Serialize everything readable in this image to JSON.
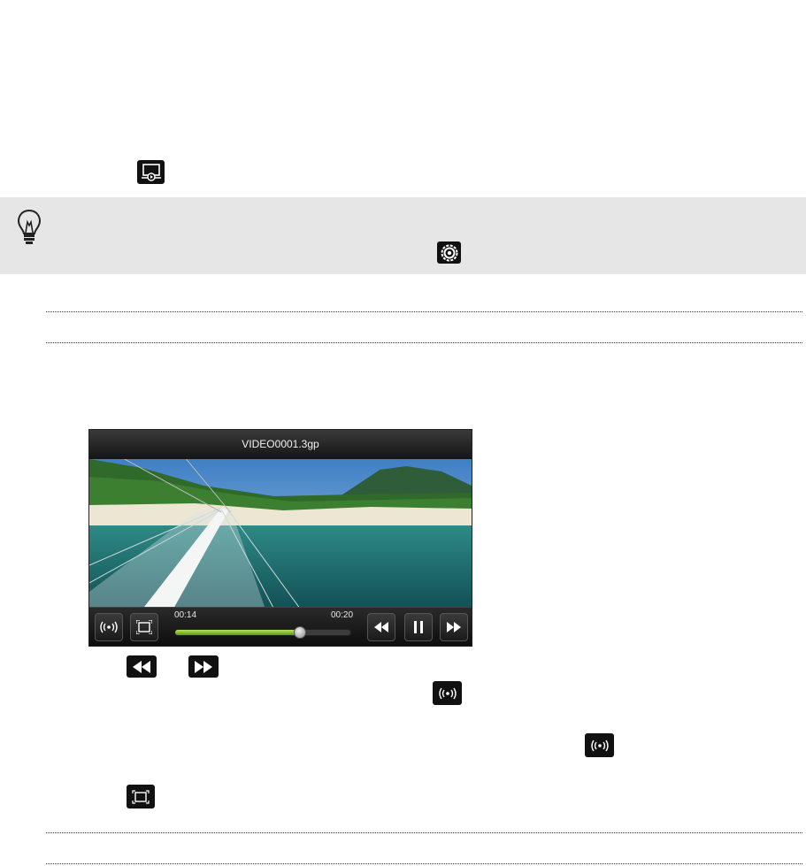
{
  "player": {
    "title": "VIDEO0001.3gp",
    "elapsed": "00:14",
    "total": "00:20",
    "progress": 0.7
  },
  "icons": {
    "screen_play": "screen-play-icon",
    "tip": "lightbulb-icon",
    "settings": "gear-icon",
    "rewind": "rewind-icon",
    "fast_forward": "fast-forward-icon",
    "surround": "surround-sound-icon",
    "fullscreen": "fullscreen-icon",
    "pause": "pause-icon"
  },
  "colors": {
    "tip_background": "#e6e6e6",
    "progress_fill": "#7fbf2a"
  }
}
